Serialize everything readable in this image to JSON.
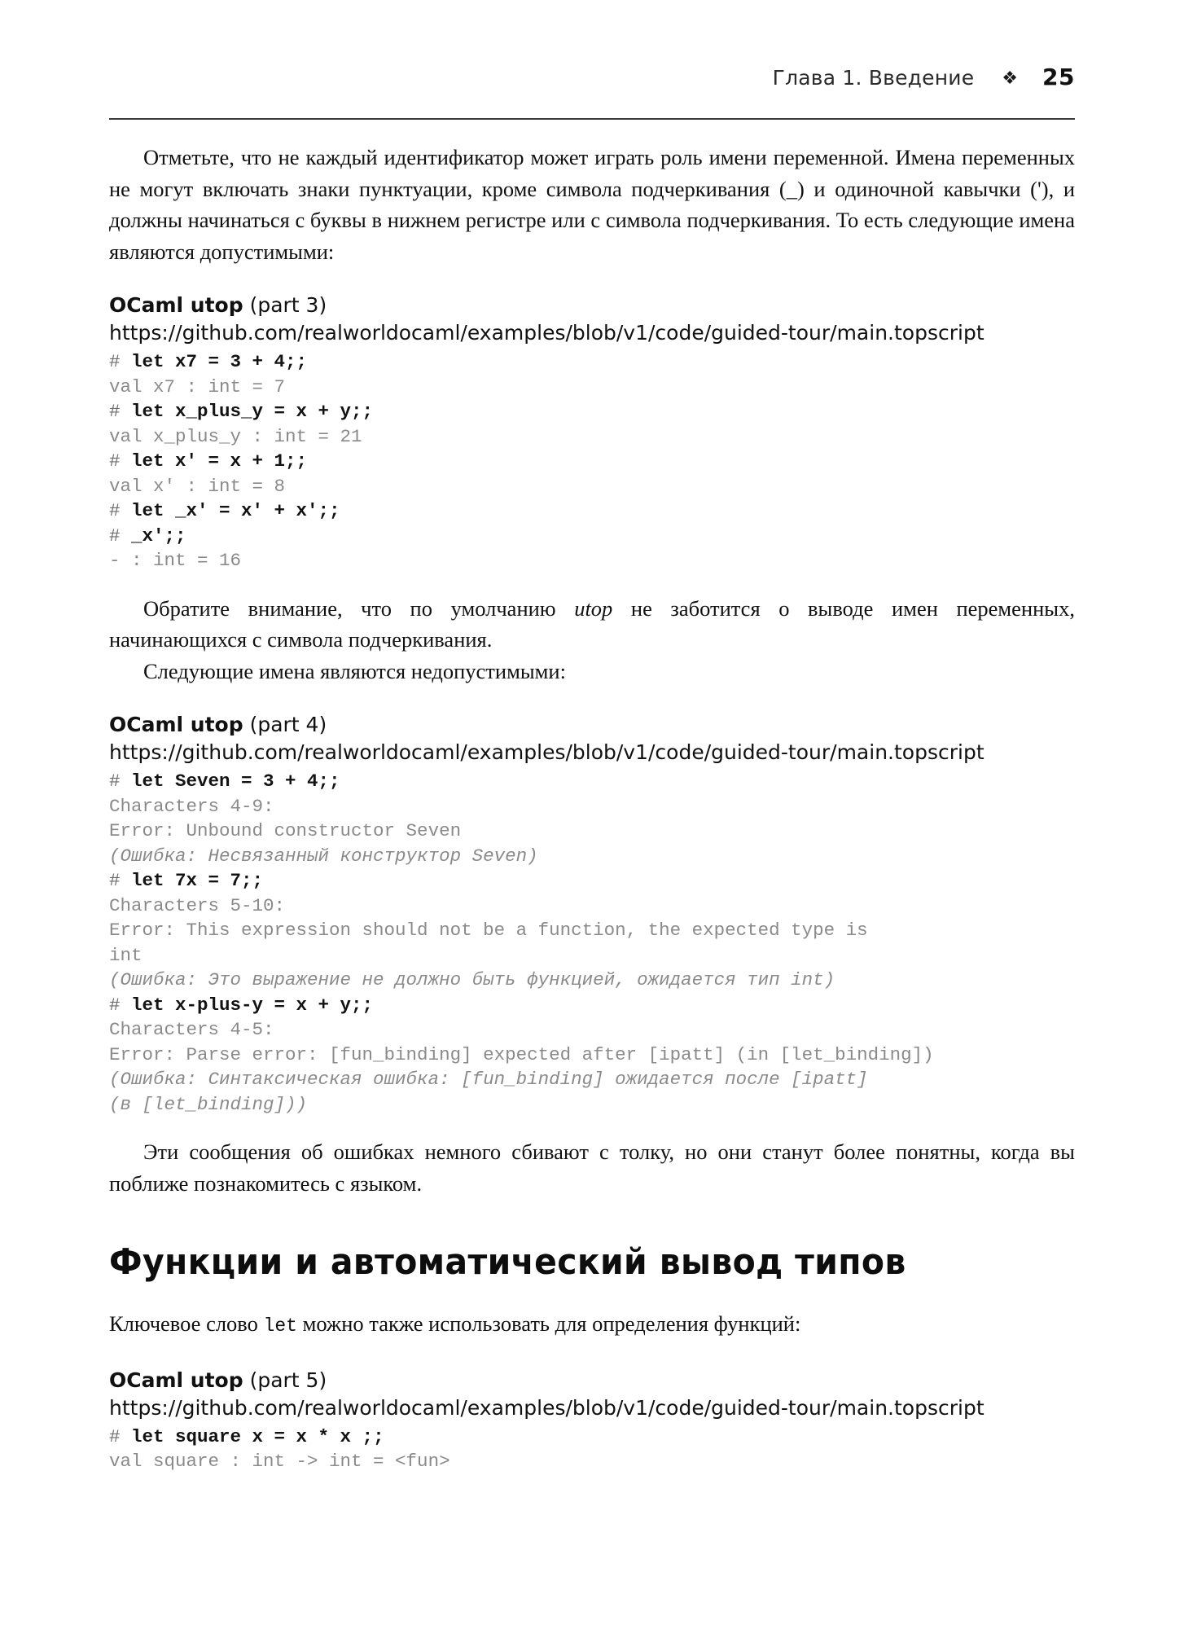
{
  "header": {
    "chapter": "Глава 1. Введение",
    "ornament": "❖",
    "page_number": "25"
  },
  "paragraphs": {
    "intro": "Отметьте, что не каждый идентификатор может играть роль имени переменной. Имена переменных не могут включать знаки пунктуации, кроме символа подчеркивания (_) и одиночной кавычки ('), и должны начинаться с буквы в нижнем регистре или с символа подчеркивания. То есть следующие имена являются допустимыми:",
    "note_before": "Обратите внимание, что по умолчанию ",
    "note_italic": "utop",
    "note_after": " не заботится о выводе имен переменных, начинающихся с символа подчеркивания.",
    "invalid_lead": "Следующие имена являются недопустимыми:",
    "confusing": "Эти сообщения об ошибках немного сбивают с толку, но они станут более понятны, когда вы поближе познакомитесь с языком.",
    "let_before": "Ключевое слово ",
    "let_mono": "let",
    "let_after": " можно также использовать для определения функций:"
  },
  "section": {
    "title": "Функции и автоматический вывод типов"
  },
  "listings": [
    {
      "name": "OCaml utop",
      "part": "(part 3)",
      "url": "https://github.com/realworldocaml/examples/blob/v1/code/guided-tour/main.topscript",
      "lines": [
        {
          "kind": "in",
          "prompt": "# ",
          "text": "let x7 = 3 + 4;;"
        },
        {
          "kind": "out",
          "text": "val x7 : int = 7"
        },
        {
          "kind": "in",
          "prompt": "# ",
          "text": "let x_plus_y = x + y;;"
        },
        {
          "kind": "out",
          "text": "val x_plus_y : int = 21"
        },
        {
          "kind": "in",
          "prompt": "# ",
          "text": "let x' = x + 1;;"
        },
        {
          "kind": "out",
          "text": "val x' : int = 8"
        },
        {
          "kind": "in",
          "prompt": "# ",
          "text": "let _x' = x' + x';;"
        },
        {
          "kind": "in",
          "prompt": "# ",
          "text": "_x';;"
        },
        {
          "kind": "out",
          "text": "- : int = 16"
        }
      ]
    },
    {
      "name": "OCaml utop",
      "part": "(part 4)",
      "url": "https://github.com/realworldocaml/examples/blob/v1/code/guided-tour/main.topscript",
      "lines": [
        {
          "kind": "in",
          "prompt": "# ",
          "text": "let Seven = 3 + 4;;"
        },
        {
          "kind": "out",
          "text": "Characters 4-9:"
        },
        {
          "kind": "out",
          "text": "Error: Unbound constructor Seven"
        },
        {
          "kind": "tr",
          "text": "(Ошибка: Несвязанный конструктор Seven)"
        },
        {
          "kind": "in",
          "prompt": "# ",
          "text": "let 7x = 7;;"
        },
        {
          "kind": "out",
          "text": "Characters 5-10:"
        },
        {
          "kind": "out",
          "text": "Error: This expression should not be a function, the expected type is"
        },
        {
          "kind": "out",
          "text": "int"
        },
        {
          "kind": "tr",
          "text": "(Ошибка: Это выражение не должно быть функцией, ожидается тип int)"
        },
        {
          "kind": "in",
          "prompt": "# ",
          "text": "let x-plus-y = x + y;;"
        },
        {
          "kind": "out",
          "text": "Characters 4-5:"
        },
        {
          "kind": "out",
          "text": "Error: Parse error: [fun_binding] expected after [ipatt] (in [let_binding])"
        },
        {
          "kind": "tr",
          "text": "(Ошибка: Синтаксическая ошибка: [fun_binding] ожидается после [ipatt]"
        },
        {
          "kind": "tr",
          "text": "(в [let_binding]))"
        }
      ]
    },
    {
      "name": "OCaml utop",
      "part": "(part 5)",
      "url": "https://github.com/realworldocaml/examples/blob/v1/code/guided-tour/main.topscript",
      "lines": [
        {
          "kind": "in",
          "prompt": "# ",
          "text": "let square x = x * x ;;"
        },
        {
          "kind": "out",
          "text": "val square : int -> int = <fun>"
        }
      ]
    }
  ]
}
